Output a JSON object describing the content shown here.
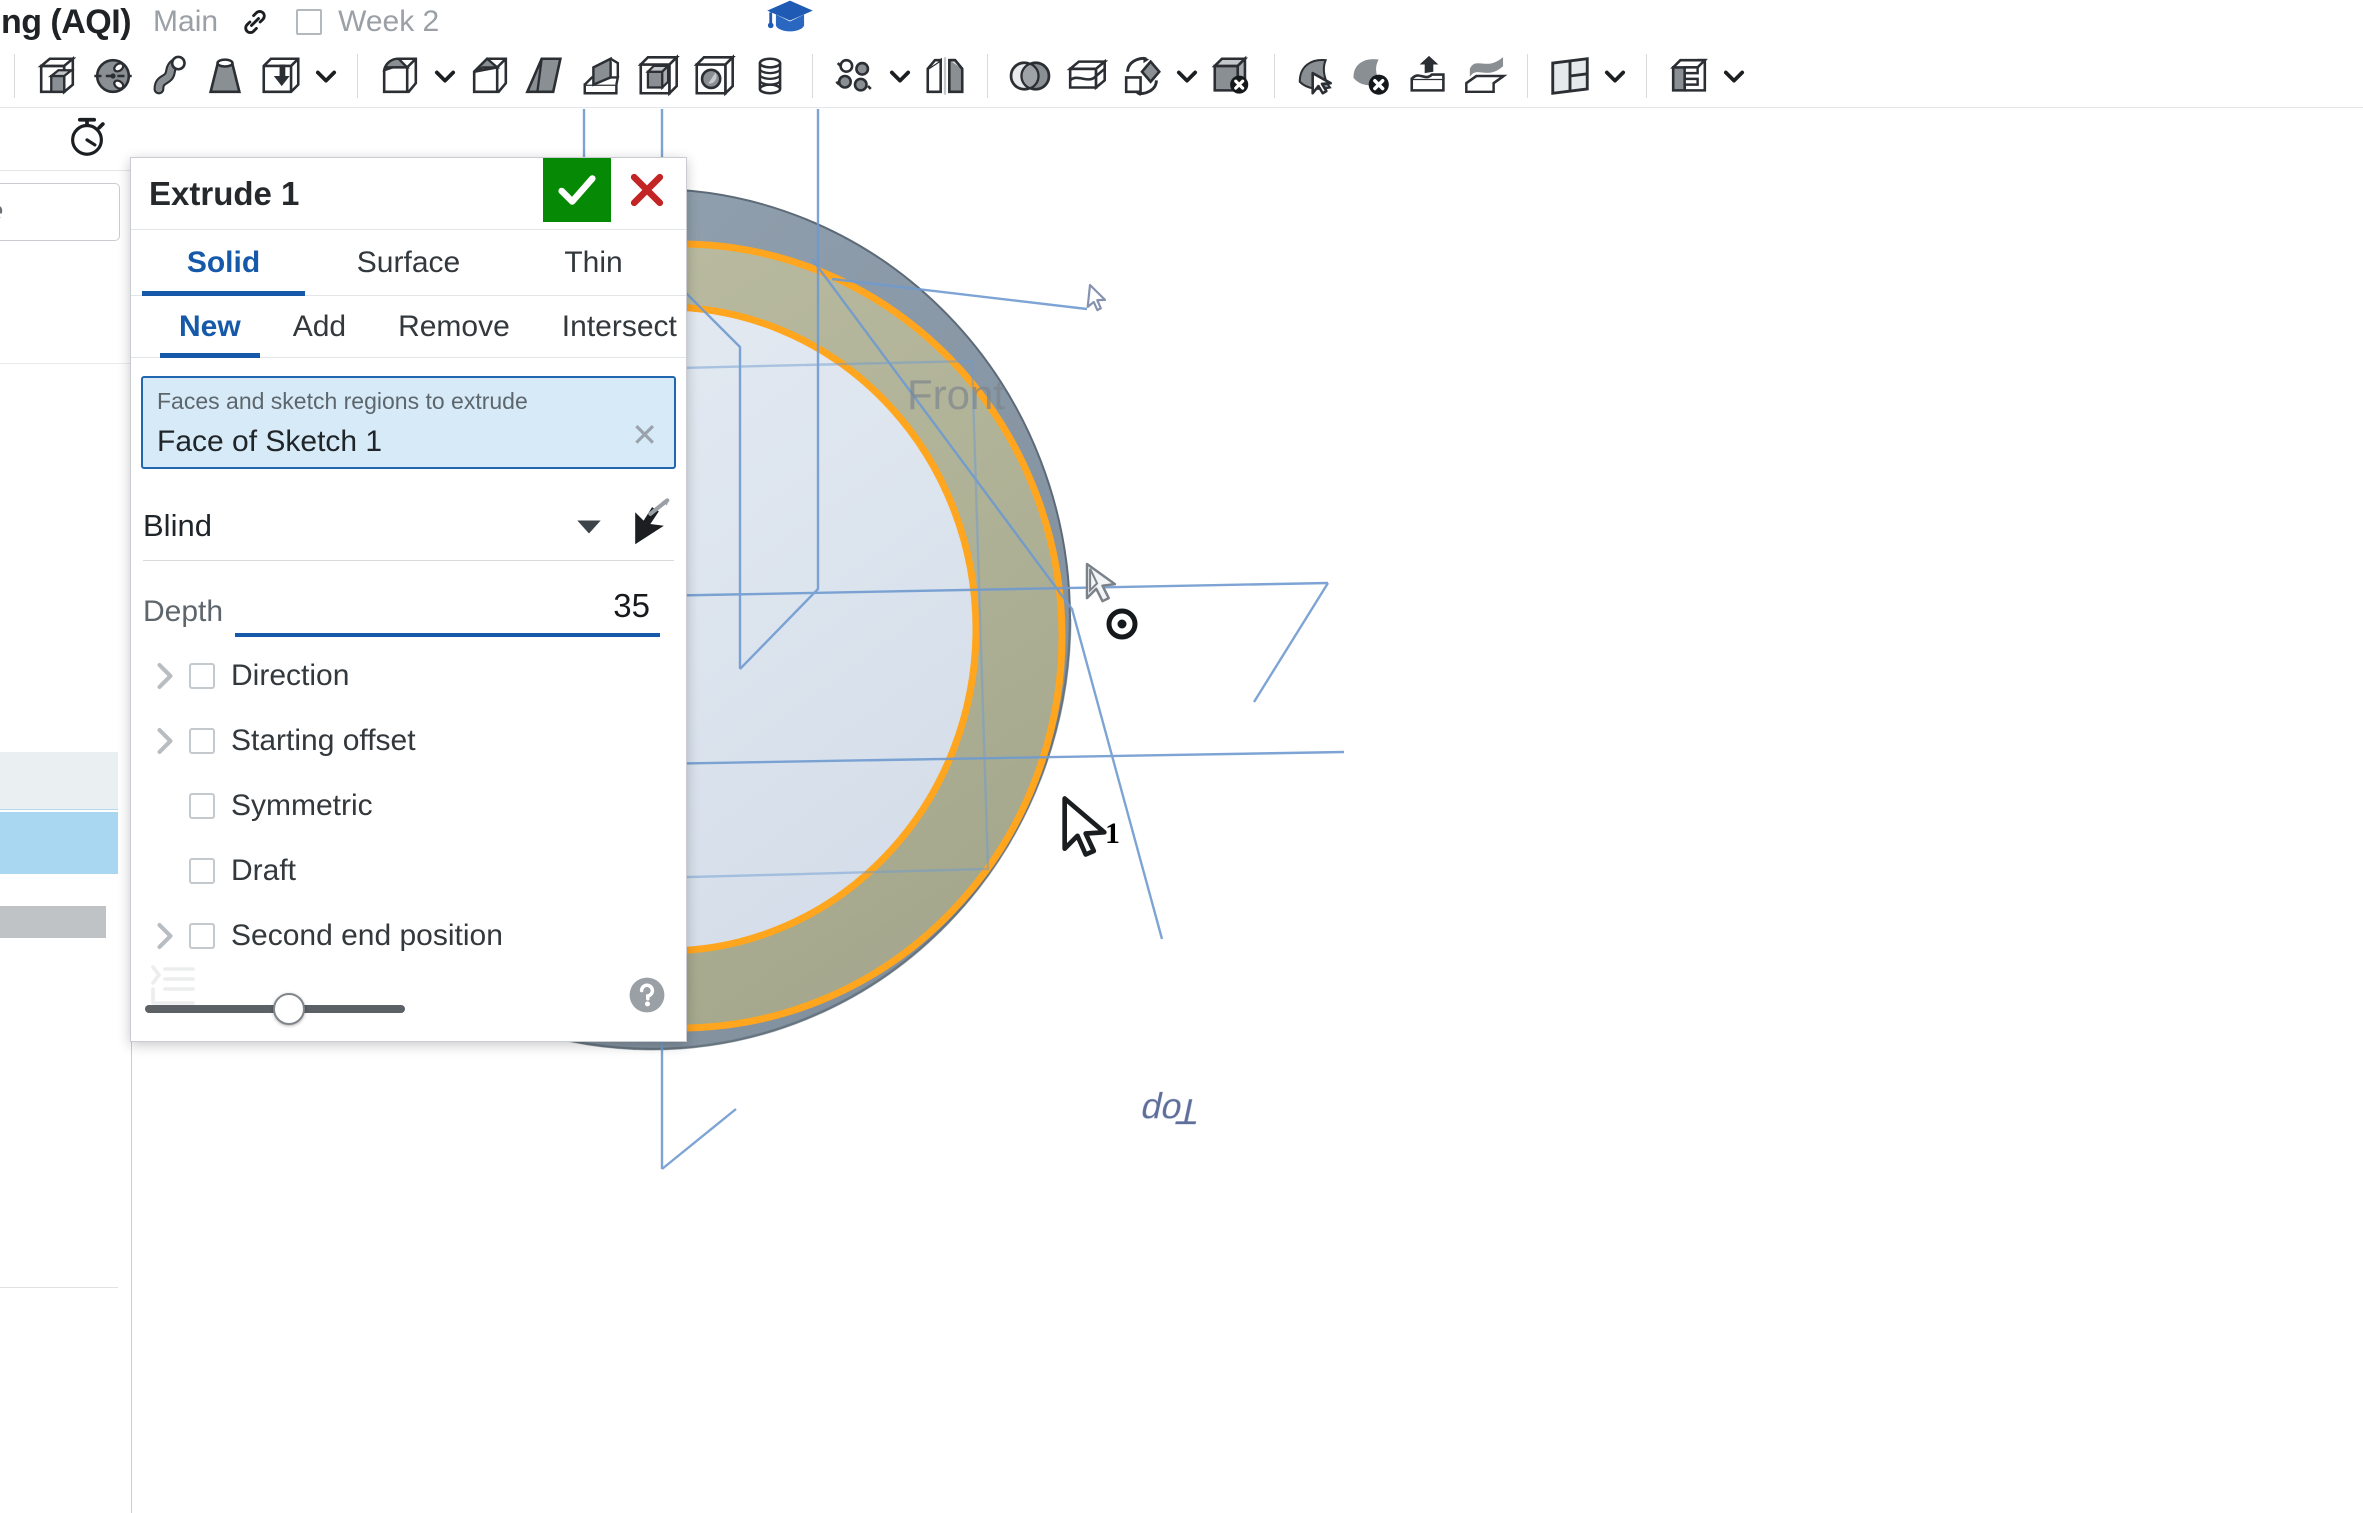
{
  "document_bar": {
    "title": "ing (AQI)",
    "branch": "Main",
    "link_icon": "link-icon",
    "workspace_checkbox_checked": false,
    "workspace_label": "Week 2",
    "learning_icon": "graduation-cap-icon"
  },
  "toolbar": {
    "groups": [
      {
        "items": [
          {
            "name": "extrude-tool",
            "label": "Extrude",
            "caret": false
          },
          {
            "name": "revolve-tool",
            "label": "Revolve",
            "caret": false
          },
          {
            "name": "sweep-tool",
            "label": "Sweep",
            "caret": false
          },
          {
            "name": "loft-tool",
            "label": "Loft",
            "caret": false
          },
          {
            "name": "thicken-tool",
            "label": "Thicken",
            "caret": true
          }
        ]
      },
      {
        "items": [
          {
            "name": "fillet-tool",
            "label": "Fillet",
            "caret": true
          },
          {
            "name": "chamfer-tool",
            "label": "Chamfer",
            "caret": false
          },
          {
            "name": "draft-tool",
            "label": "Draft",
            "caret": false
          },
          {
            "name": "rib-tool",
            "label": "Rib",
            "caret": false
          },
          {
            "name": "shell-tool",
            "label": "Shell",
            "caret": false
          },
          {
            "name": "hole-tool",
            "label": "Hole",
            "caret": false
          },
          {
            "name": "thread-tool",
            "label": "Thread",
            "caret": false
          }
        ]
      },
      {
        "items": [
          {
            "name": "pattern-tool",
            "label": "Pattern",
            "caret": true
          },
          {
            "name": "mirror-tool",
            "label": "Mirror",
            "caret": false
          }
        ]
      },
      {
        "items": [
          {
            "name": "boolean-tool",
            "label": "Boolean",
            "caret": false
          },
          {
            "name": "split-tool",
            "label": "Split",
            "caret": false
          },
          {
            "name": "transform-tool",
            "label": "Transform",
            "caret": true
          },
          {
            "name": "delete-part-tool",
            "label": "Delete part",
            "caret": false
          }
        ]
      },
      {
        "items": [
          {
            "name": "move-face-tool",
            "label": "Move face",
            "caret": false
          },
          {
            "name": "delete-face-tool",
            "label": "Delete face",
            "caret": false
          },
          {
            "name": "replace-face-tool",
            "label": "Replace face",
            "caret": false
          },
          {
            "name": "offset-surface-tool",
            "label": "Offset surface",
            "caret": false
          }
        ]
      },
      {
        "items": [
          {
            "name": "plane-tool",
            "label": "Plane",
            "caret": true
          }
        ]
      },
      {
        "items": [
          {
            "name": "derived-tool",
            "label": "Derived",
            "caret": true
          }
        ]
      }
    ]
  },
  "feature_tree": {
    "stopwatch_icon": "stopwatch-icon",
    "filter_placeholder": "ype",
    "rows": [
      {
        "name": "tree-row-hover",
        "state": "hovered"
      },
      {
        "name": "tree-row-selected",
        "state": "selected"
      },
      {
        "name": "tree-row-greyed",
        "state": "greyed"
      }
    ]
  },
  "dialog": {
    "title": "Extrude 1",
    "accept_icon": "checkmark-icon",
    "cancel_icon": "close-icon",
    "type_tabs": [
      {
        "label": "Solid",
        "active": true
      },
      {
        "label": "Surface",
        "active": false
      },
      {
        "label": "Thin",
        "active": false
      }
    ],
    "operation_tabs": [
      {
        "label": "New",
        "active": true
      },
      {
        "label": "Add",
        "active": false
      },
      {
        "label": "Remove",
        "active": false
      },
      {
        "label": "Intersect",
        "active": false
      }
    ],
    "selection": {
      "hint": "Faces and sketch regions to extrude",
      "value": "Face of Sketch 1",
      "clear_icon": "clear-selection-icon"
    },
    "end_type": {
      "value": "Blind",
      "caret_icon": "chevron-down-icon",
      "tool_icon": "select-direction-icon"
    },
    "depth": {
      "label": "Depth",
      "value": "35"
    },
    "options": [
      {
        "label": "Direction",
        "checked": false,
        "expandable": true
      },
      {
        "label": "Starting offset",
        "checked": false,
        "expandable": true
      },
      {
        "label": "Symmetric",
        "checked": false,
        "expandable": false
      },
      {
        "label": "Draft",
        "checked": false,
        "expandable": false
      },
      {
        "label": "Second end position",
        "checked": false,
        "expandable": true
      }
    ],
    "footer": {
      "list_icon": "list-icon",
      "opacity_slider_value": 50,
      "help_icon": "help-icon"
    }
  },
  "viewport": {
    "plane_labels": [
      {
        "name": "front-plane-label",
        "text": "Front"
      },
      {
        "name": "top-plane-label",
        "text": "Top"
      }
    ],
    "origin_marker": "origin-icon",
    "sketch_cursor_glyph": "sketch-pointer-icon",
    "cursor_badge": "1",
    "colors": {
      "preview_outer": "#8c9cab",
      "preview_inner_khaki": "#b6b79a",
      "selection_highlight": "#ffa51e",
      "sketch_face": "#dfe6ef",
      "sketch_line": "#6f9ad0",
      "accent_blue": "#1659a8",
      "accept_green": "#068a06",
      "cancel_red": "#c32424"
    }
  }
}
